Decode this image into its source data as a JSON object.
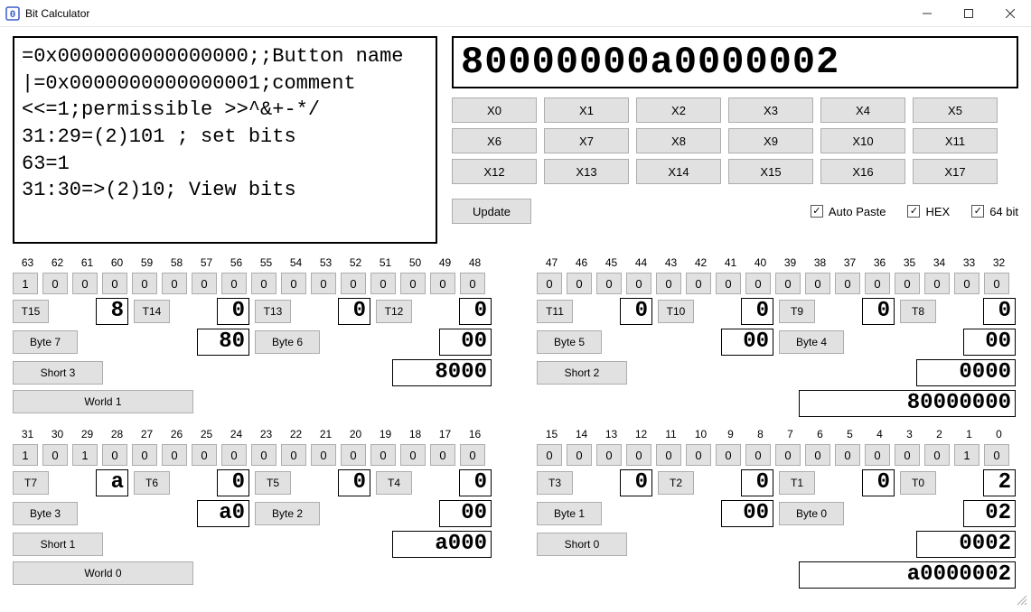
{
  "window": {
    "title": "Bit Calculator",
    "icon": "digit-zero-icon"
  },
  "script_text": "=0x0000000000000000;;Button name\n|=0x0000000000000001;comment\n<<=1;permissible >>^&+-*/\n31:29=(2)101 ; set bits\n63=1\n31:30=>(2)10; View bits",
  "big_display": "80000000a0000002",
  "x_buttons": [
    [
      "X0",
      "X1",
      "X2",
      "X3",
      "X4",
      "X5"
    ],
    [
      "X6",
      "X7",
      "X8",
      "X9",
      "X10",
      "X11"
    ],
    [
      "X12",
      "X13",
      "X14",
      "X15",
      "X16",
      "X17"
    ]
  ],
  "update_label": "Update",
  "checks": {
    "auto_paste": {
      "label": "Auto Paste",
      "checked": true
    },
    "hex": {
      "label": "HEX",
      "checked": true
    },
    "bit64": {
      "label": "64 bit",
      "checked": true
    }
  },
  "rows": [
    {
      "left": {
        "labels": [
          "63",
          "62",
          "61",
          "60",
          "59",
          "58",
          "57",
          "56",
          "55",
          "54",
          "53",
          "52",
          "51",
          "50",
          "49",
          "48"
        ],
        "bits": [
          "1",
          "0",
          "0",
          "0",
          "0",
          "0",
          "0",
          "0",
          "0",
          "0",
          "0",
          "0",
          "0",
          "0",
          "0",
          "0"
        ],
        "nibbles": [
          {
            "t": "T15",
            "v": "8"
          },
          {
            "t": "T14",
            "v": "0"
          },
          {
            "t": "T13",
            "v": "0"
          },
          {
            "t": "T12",
            "v": "0"
          }
        ],
        "bytes": [
          {
            "b": "Byte 7",
            "v": "80"
          },
          {
            "b": "Byte 6",
            "v": "00"
          }
        ],
        "short": {
          "b": "Short 3",
          "v": "8000"
        },
        "world": {
          "b": "World 1"
        }
      },
      "right": {
        "labels": [
          "47",
          "46",
          "45",
          "44",
          "43",
          "42",
          "41",
          "40",
          "39",
          "38",
          "37",
          "36",
          "35",
          "34",
          "33",
          "32"
        ],
        "bits": [
          "0",
          "0",
          "0",
          "0",
          "0",
          "0",
          "0",
          "0",
          "0",
          "0",
          "0",
          "0",
          "0",
          "0",
          "0",
          "0"
        ],
        "nibbles": [
          {
            "t": "T11",
            "v": "0"
          },
          {
            "t": "T10",
            "v": "0"
          },
          {
            "t": "T9",
            "v": "0"
          },
          {
            "t": "T8",
            "v": "0"
          }
        ],
        "bytes": [
          {
            "b": "Byte 5",
            "v": "00"
          },
          {
            "b": "Byte 4",
            "v": "00"
          }
        ],
        "short": {
          "b": "Short 2",
          "v": "0000"
        },
        "world_val": "80000000"
      }
    },
    {
      "left": {
        "labels": [
          "31",
          "30",
          "29",
          "28",
          "27",
          "26",
          "25",
          "24",
          "23",
          "22",
          "21",
          "20",
          "19",
          "18",
          "17",
          "16"
        ],
        "bits": [
          "1",
          "0",
          "1",
          "0",
          "0",
          "0",
          "0",
          "0",
          "0",
          "0",
          "0",
          "0",
          "0",
          "0",
          "0",
          "0"
        ],
        "nibbles": [
          {
            "t": "T7",
            "v": "a"
          },
          {
            "t": "T6",
            "v": "0"
          },
          {
            "t": "T5",
            "v": "0"
          },
          {
            "t": "T4",
            "v": "0"
          }
        ],
        "bytes": [
          {
            "b": "Byte 3",
            "v": "a0"
          },
          {
            "b": "Byte 2",
            "v": "00"
          }
        ],
        "short": {
          "b": "Short 1",
          "v": "a000"
        },
        "world": {
          "b": "World 0"
        }
      },
      "right": {
        "labels": [
          "15",
          "14",
          "13",
          "12",
          "11",
          "10",
          "9",
          "8",
          "7",
          "6",
          "5",
          "4",
          "3",
          "2",
          "1",
          "0"
        ],
        "bits": [
          "0",
          "0",
          "0",
          "0",
          "0",
          "0",
          "0",
          "0",
          "0",
          "0",
          "0",
          "0",
          "0",
          "0",
          "1",
          "0"
        ],
        "nibbles": [
          {
            "t": "T3",
            "v": "0"
          },
          {
            "t": "T2",
            "v": "0"
          },
          {
            "t": "T1",
            "v": "0"
          },
          {
            "t": "T0",
            "v": "2"
          }
        ],
        "bytes": [
          {
            "b": "Byte 1",
            "v": "00"
          },
          {
            "b": "Byte 0",
            "v": "02"
          }
        ],
        "short": {
          "b": "Short 0",
          "v": "0002"
        },
        "world_val": "a0000002"
      }
    }
  ]
}
